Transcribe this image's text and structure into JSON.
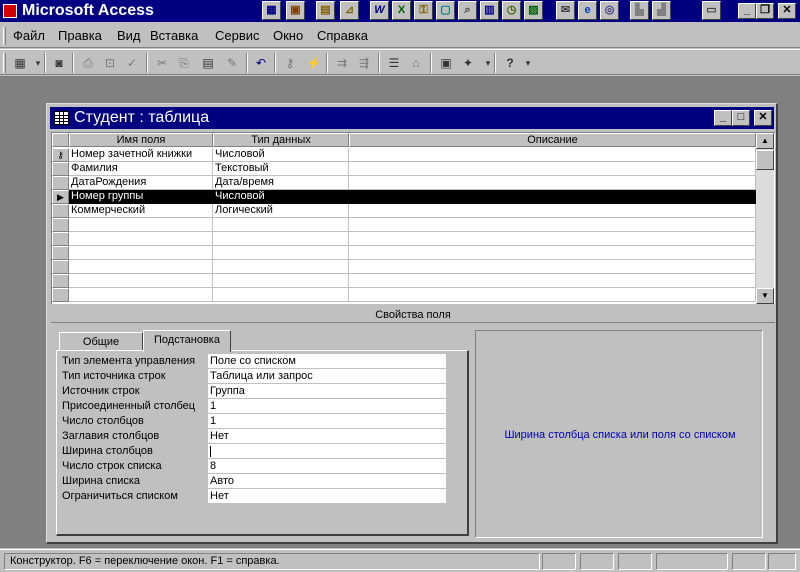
{
  "app": {
    "title": "Microsoft Access"
  },
  "menu": [
    "Файл",
    "Правка",
    "Вид",
    "Вставка",
    "Сервис",
    "Окно",
    "Справка"
  ],
  "window": {
    "title": "Студент : таблица",
    "columns": [
      "Имя поля",
      "Тип данных",
      "Описание"
    ],
    "rows": [
      {
        "name": "Номер зачетной книжки",
        "type": "Числовой",
        "description": "",
        "indicator": "key"
      },
      {
        "name": "Фамилия",
        "type": "Текстовый",
        "description": "",
        "indicator": ""
      },
      {
        "name": "ДатаРождения",
        "type": "Дата/время",
        "description": "",
        "indicator": ""
      },
      {
        "name": "Номер группы",
        "type": "Числовой",
        "description": "",
        "indicator": "current"
      },
      {
        "name": "Коммерческий",
        "type": "Логический",
        "description": "",
        "indicator": ""
      }
    ],
    "empty_rows": 6,
    "field_properties_label": "Свойства поля",
    "tabs": [
      {
        "label": "Общие",
        "active": false
      },
      {
        "label": "Подстановка",
        "active": true
      }
    ],
    "properties": [
      {
        "name": "Тип элемента управления",
        "value": "Поле со списком"
      },
      {
        "name": "Тип источника строк",
        "value": "Таблица или запрос"
      },
      {
        "name": "Источник строк",
        "value": "Группа"
      },
      {
        "name": "Присоединенный столбец",
        "value": "1"
      },
      {
        "name": "Число столбцов",
        "value": "1"
      },
      {
        "name": "Заглавия столбцов",
        "value": "Нет"
      },
      {
        "name": "Ширина столбцов",
        "value": "",
        "caret": true
      },
      {
        "name": "Число строк списка",
        "value": "8"
      },
      {
        "name": "Ширина списка",
        "value": "Авто"
      },
      {
        "name": "Ограничиться списком",
        "value": "Нет"
      }
    ],
    "help_text": "Ширина столбца списка или поля со списком"
  },
  "status": {
    "text": "Конструктор.  F6 = переключение окон.  F1 = справка.",
    "panes": 5
  },
  "colors": {
    "title_bar": "#000080",
    "face": "#c0c0c0",
    "mdi_background": "#808080",
    "help_text": "#0000a8",
    "selected_row": "#000000"
  },
  "icons": {
    "office_shortcuts": [
      "word-icon",
      "excel-icon",
      "key-icon",
      "screen-icon",
      "search-icon",
      "book-icon",
      "clock-icon",
      "chart-icon",
      "mail-icon",
      "ie-icon",
      "net-icon",
      "paint-icon",
      "printer-icon",
      "printer2-icon",
      "notes-icon"
    ],
    "toolbar": [
      "view-icon",
      "save-icon",
      "print-icon",
      "preview-icon",
      "spell-icon",
      "cut-icon",
      "copy-icon",
      "paste-icon",
      "format-painter-icon",
      "undo-icon",
      "primary-key-icon",
      "indexes-icon",
      "insert-rows-icon",
      "delete-rows-icon",
      "properties-icon",
      "build-icon",
      "database-window-icon",
      "new-object-icon",
      "help-icon"
    ]
  }
}
